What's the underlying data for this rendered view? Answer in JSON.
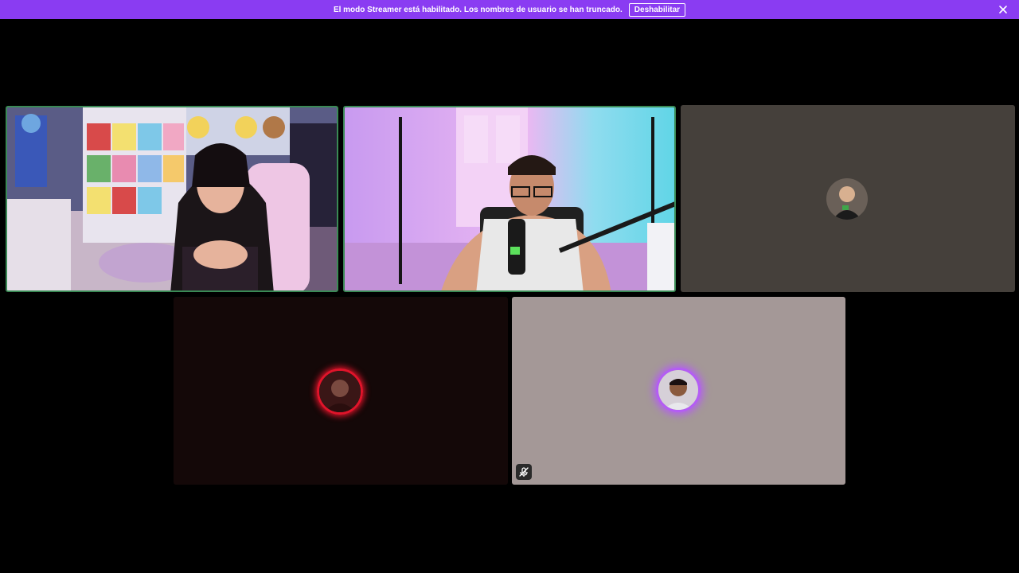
{
  "banner": {
    "message": "El modo Streamer está habilitado. Los nombres de usuario se han truncado.",
    "disable_label": "Deshabilitar",
    "close_icon": "close-icon",
    "background": "#8a3cf2"
  },
  "call": {
    "participants": [
      {
        "kind": "video",
        "speaking": true,
        "description_icon": "webcam-video"
      },
      {
        "kind": "video",
        "speaking": true,
        "description_icon": "webcam-video"
      },
      {
        "kind": "avatar",
        "background": "#45403b"
      },
      {
        "kind": "avatar",
        "background": "#140808",
        "ring": "#e0142a"
      },
      {
        "kind": "avatar",
        "background": "#a49897",
        "ring": "#b45cf5",
        "muted": true,
        "mute_icon": "microphone-muted-icon"
      }
    ]
  }
}
